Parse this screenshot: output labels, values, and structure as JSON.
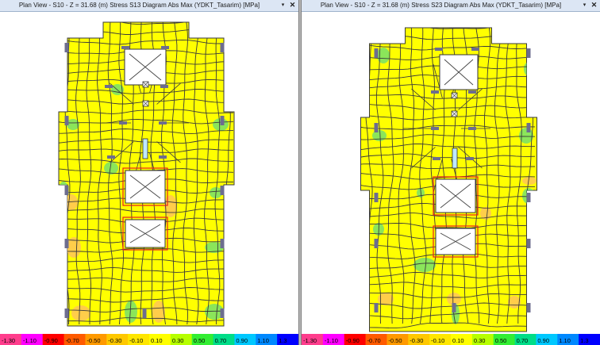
{
  "left_view": {
    "title": "Plan View - S10 - Z = 31.68 (m)   Stress S13 Diagram  Abs Max   (YDKT_Tasarim)  [MPa]",
    "dropdown_icon": "chevron-down-icon",
    "close_icon": "close-icon"
  },
  "right_view": {
    "title": "Plan View - S10 - Z = 31.68 (m)   Stress S23 Diagram  Abs Max   (YDKT_Tasarim)  [MPa]",
    "dropdown_icon": "chevron-down-icon",
    "close_icon": "close-icon"
  },
  "scale": {
    "labels": [
      "-1.30",
      "-1.10",
      "-0.90",
      "-0.70",
      "-0.50",
      "-0.30",
      "-0.10",
      "0.10",
      "0.30",
      "0.50",
      "0.70",
      "0.90",
      "1.10",
      "1.3"
    ],
    "colors": [
      "#ff3d8c",
      "#ff00ff",
      "#ff0000",
      "#ff5a00",
      "#ff9900",
      "#ffc800",
      "#ffe600",
      "#ffff00",
      "#b6ff00",
      "#33ee33",
      "#00dd88",
      "#00c8ff",
      "#0088ff",
      "#0000ff"
    ]
  },
  "colors": {
    "slab": "#ffff00",
    "mesh": "#3a3a3a",
    "column": "#6d6d8f",
    "opening_border": "#e8201a",
    "hot_orange": "#ffc457",
    "hot_green": "#77e06a"
  }
}
